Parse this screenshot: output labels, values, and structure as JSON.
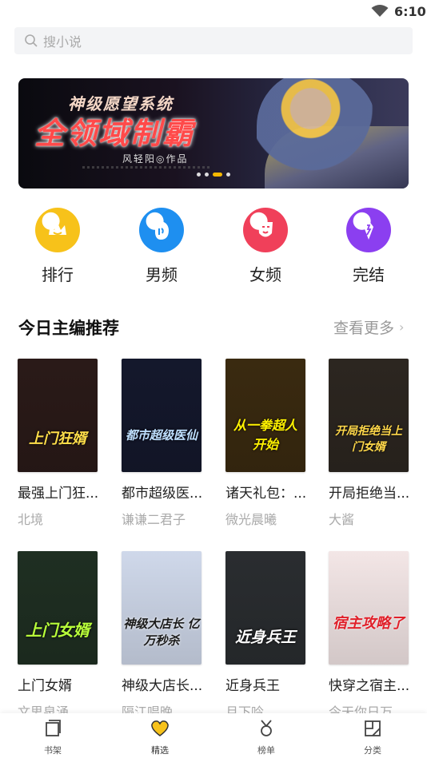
{
  "status_bar": {
    "time": "6:10"
  },
  "search": {
    "placeholder": "搜小说"
  },
  "banner": {
    "title_top": "神级愿望系统",
    "title_main": "全领域制霸",
    "author_line": "风轻阳◎作品",
    "slide_count": 4,
    "active_slide": 3
  },
  "categories": [
    {
      "label": "排行",
      "color": "#f7c21a",
      "icon": "crown-icon"
    },
    {
      "label": "男频",
      "color": "#1e8ff0",
      "icon": "male-face-icon"
    },
    {
      "label": "女频",
      "color": "#f0405a",
      "icon": "female-face-icon"
    },
    {
      "label": "完结",
      "color": "#8b3ff0",
      "icon": "finished-icon"
    }
  ],
  "section": {
    "title": "今日主编推荐",
    "more": "查看更多"
  },
  "books": [
    {
      "title": "最强上门狂...",
      "author": "北境",
      "cover_text": "上门狂婿",
      "cover_bg": "#2a1a18"
    },
    {
      "title": "都市超级医...",
      "author": "谦谦二君子",
      "cover_text": "都市超级医仙",
      "cover_bg": "#14182c"
    },
    {
      "title": "诸天礼包：...",
      "author": "微光晨曦",
      "cover_text": "从一拳超人开始",
      "cover_bg": "#3a2a10"
    },
    {
      "title": "开局拒绝当...",
      "author": "大酱",
      "cover_text": "开局拒绝当上门女婿",
      "cover_bg": "#2c2620"
    },
    {
      "title": "上门女婿",
      "author": "文思泉涌",
      "cover_text": "上门女婿",
      "cover_bg": "#1f2f22"
    },
    {
      "title": "神级大店长...",
      "author": "隔江唱晚",
      "cover_text": "神级大店长 亿万秒杀",
      "cover_bg": "#cfd8ea"
    },
    {
      "title": "近身兵王",
      "author": "月下吟",
      "cover_text": "近身兵王",
      "cover_bg": "#2a2d30"
    },
    {
      "title": "快穿之宿主...",
      "author": "今天你日万...",
      "cover_text": "宿主攻略了",
      "cover_bg": "#f3e6e6"
    }
  ],
  "tabs": [
    {
      "label": "书架",
      "active": false
    },
    {
      "label": "精选",
      "active": true
    },
    {
      "label": "榜单",
      "active": false
    },
    {
      "label": "分类",
      "active": false
    }
  ]
}
